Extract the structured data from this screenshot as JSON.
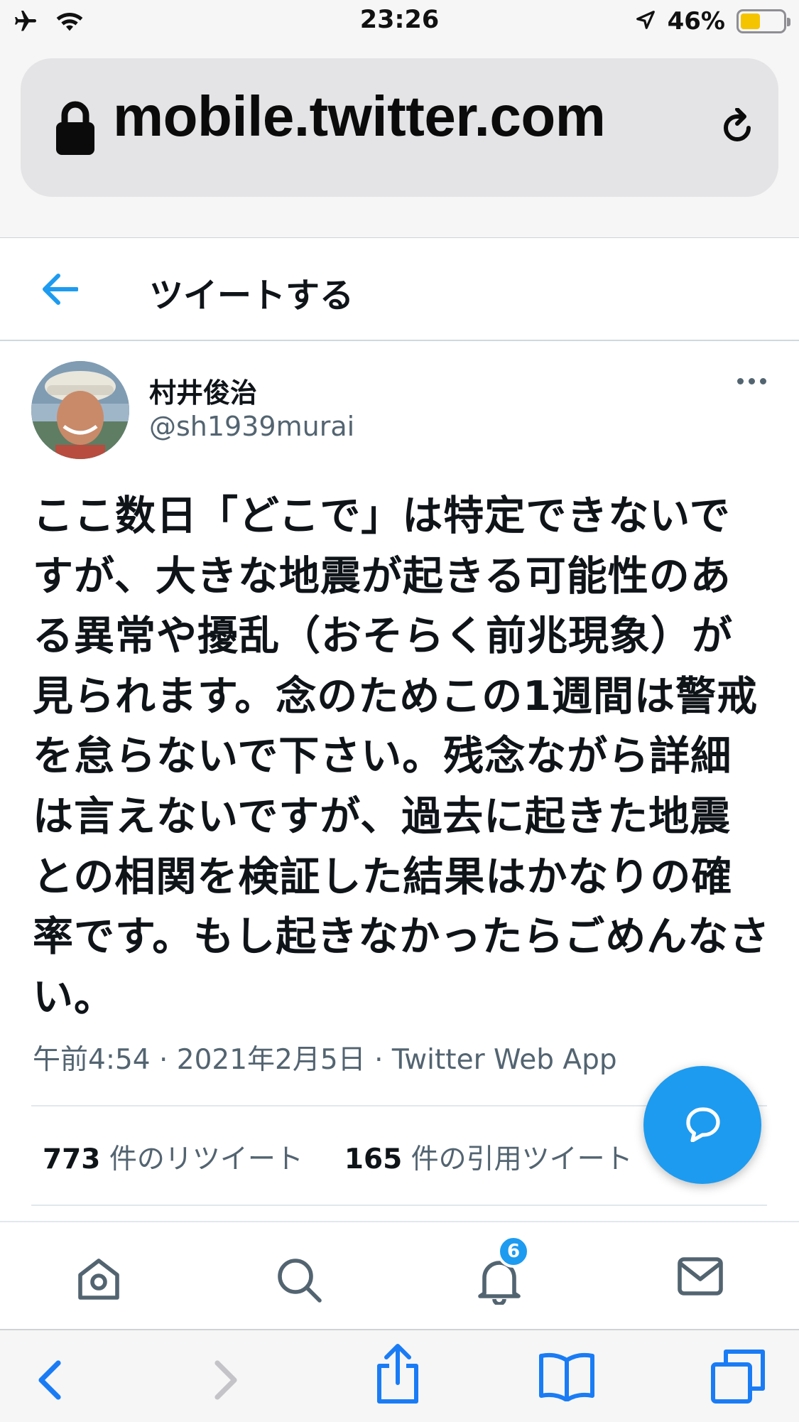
{
  "status_bar": {
    "time": "23:26",
    "battery_percent_label": "46%",
    "battery_level": 0.46,
    "icons": [
      "airplane-icon",
      "wifi-icon",
      "location-arrow-icon",
      "battery-icon"
    ]
  },
  "browser": {
    "url": "mobile.twitter.com",
    "icons": [
      "lock-icon",
      "reload-icon"
    ]
  },
  "header": {
    "title": "ツイートする",
    "back_icon": "back-arrow-icon"
  },
  "tweet": {
    "author_name": "村井俊治",
    "author_handle": "@sh1939murai",
    "text": "ここ数日「どこで」は特定できないですが、大きな地震が起きる可能性のある異常や擾乱（おそらく前兆現象）が見られます。念のためこの1週間は警戒を怠らないで下さい。残念ながら詳細は言えないですが、過去に起きた地震との相関を検証した結果はかなりの確率です。もし起きなかったらごめんなさい。",
    "time": "午前4:54",
    "date": "2021年2月5日",
    "separator": " · ",
    "source": "Twitter Web App",
    "retweets_count": "773",
    "retweets_label": " 件のリツイート",
    "quotes_count": "165",
    "quotes_label": " 件の引用ツイート"
  },
  "bottom_nav": {
    "items": [
      "home-icon",
      "search-icon",
      "notifications-icon",
      "messages-icon"
    ],
    "notification_badge": "6"
  },
  "safari_toolbar": {
    "items": [
      "back-icon",
      "forward-icon",
      "share-icon",
      "bookmarks-icon",
      "tabs-icon"
    ]
  },
  "colors": {
    "accent": "#1d9bf0",
    "text": "#0f1419",
    "secondary_text": "#536471",
    "safari_icon": "#1a7cf5"
  }
}
